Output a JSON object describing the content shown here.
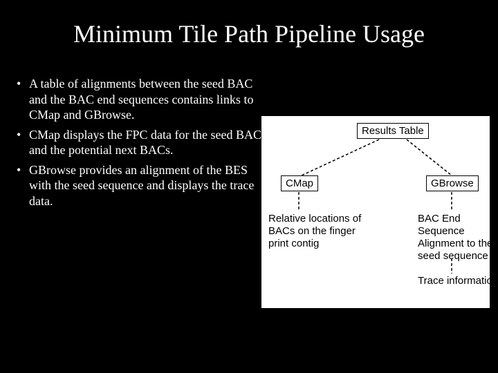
{
  "title": "Minimum Tile Path Pipeline Usage",
  "bullets": [
    "A table of alignments between the seed BAC and the BAC end sequences contains links to CMap and GBrowse.",
    "CMap displays the FPC data for the seed BAC and the potential next BACs.",
    "GBrowse provides an alignment of the BES with the seed sequence and displays the trace data."
  ],
  "diagram": {
    "results": "Results Table",
    "cmap": "CMap",
    "gbrowse": "GBrowse",
    "desc_cmap": "Relative locations of BACs on the finger print contig",
    "desc_gbrowse_1": "BAC End Sequence Alignment to the seed sequence",
    "desc_gbrowse_2": "Trace information"
  }
}
